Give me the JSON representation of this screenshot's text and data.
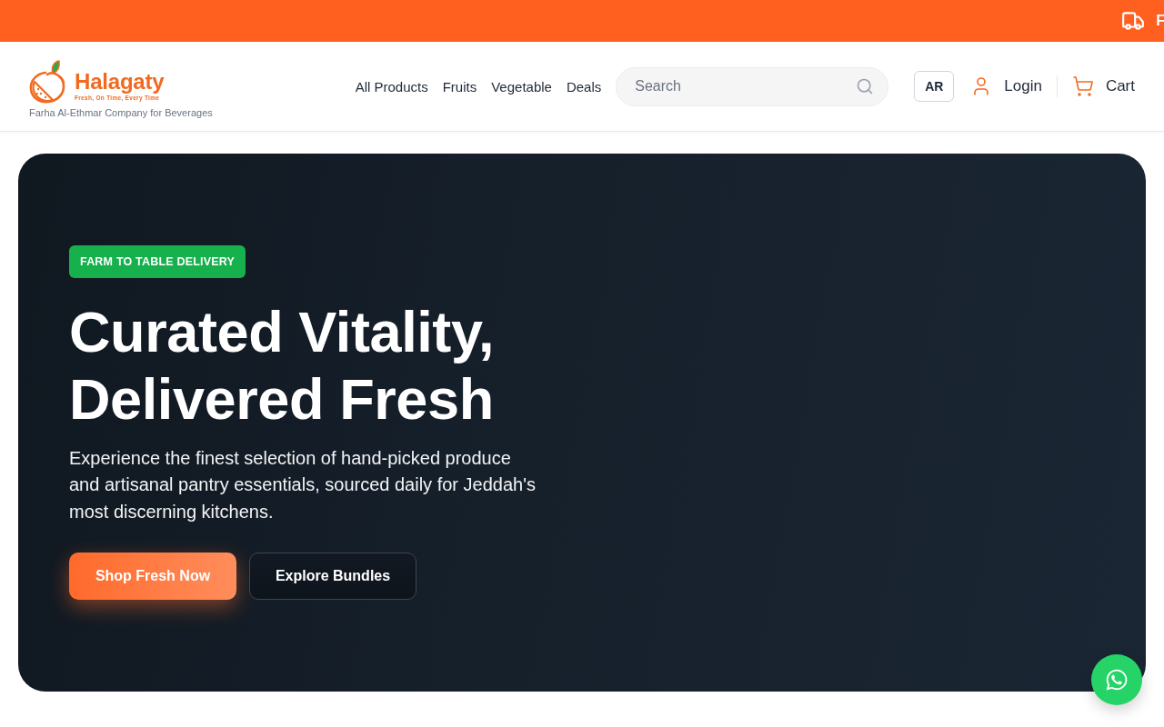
{
  "promo_banner": {
    "text": "F"
  },
  "header": {
    "logo": {
      "name": "Halagaty",
      "tagline": "Fresh, On Time, Every Time"
    },
    "company": "Farha Al-Ethmar Company for Beverages",
    "nav": [
      {
        "label": "All Products"
      },
      {
        "label": "Fruits"
      },
      {
        "label": "Vegetable"
      },
      {
        "label": "Deals"
      }
    ],
    "search": {
      "placeholder": "Search"
    },
    "language_button": "AR",
    "login": "Login",
    "cart": "Cart"
  },
  "hero": {
    "badge": "FARM TO TABLE DELIVERY",
    "headline": "Curated Vitality, Delivered Fresh",
    "description": "Experience the finest selection of hand-picked produce and artisanal pantry essentials, sourced daily for Jeddah's most discerning kitchens.",
    "buttons": [
      {
        "label": "Shop Fresh Now",
        "kind": "primary"
      },
      {
        "label": "Explore Bundles",
        "kind": "secondary"
      }
    ]
  }
}
